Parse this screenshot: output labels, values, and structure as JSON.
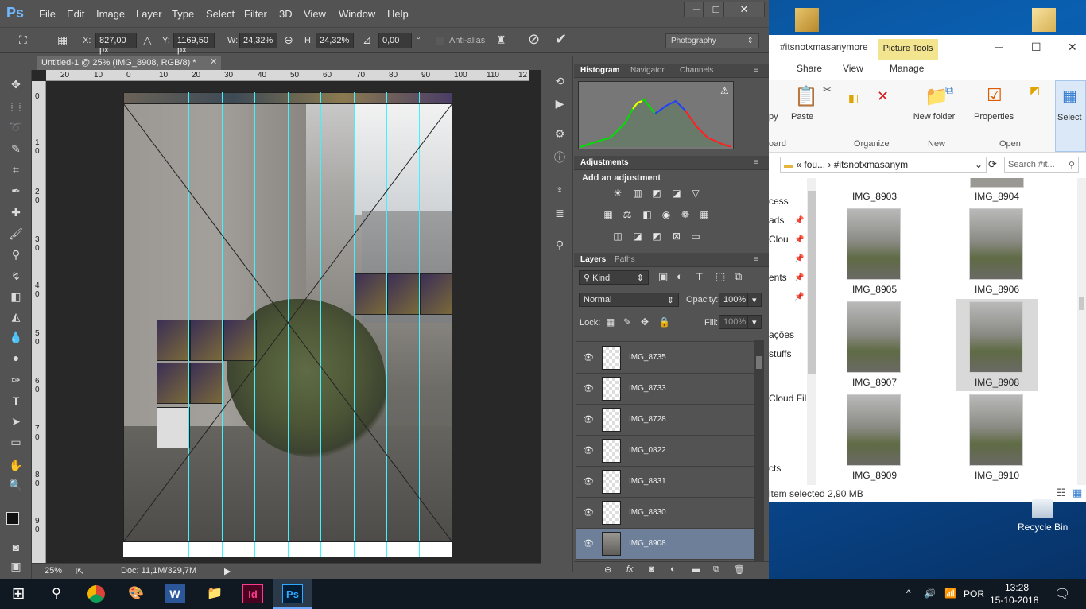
{
  "photoshop": {
    "logo": "Ps",
    "menu": [
      "File",
      "Edit",
      "Image",
      "Layer",
      "Type",
      "Select",
      "Filter",
      "3D",
      "View",
      "Window",
      "Help"
    ],
    "options": {
      "x_label": "X:",
      "x_value": "827,00 px",
      "y_label": "Y:",
      "y_value": "1169,50 px",
      "w_label": "W:",
      "w_value": "24,32%",
      "h_label": "H:",
      "h_value": "24,32%",
      "angle_value": "0,00",
      "angle_unit": "°",
      "anti_alias_label": "Anti-alias",
      "workspace": "Photography"
    },
    "document_tab": "Untitled-1 @ 25% (IMG_8908, RGB/8) *",
    "ruler_top_ticks": [
      "20",
      "10",
      "0",
      "10",
      "20",
      "30",
      "40",
      "50",
      "60",
      "70",
      "80",
      "90",
      "100",
      "110",
      "12"
    ],
    "ruler_left_ticks": [
      "0",
      "1 0",
      "2 0",
      "3 0",
      "4 0",
      "5 0",
      "6 0",
      "7 0",
      "8 0",
      "9 0"
    ],
    "status": {
      "zoom": "25%",
      "doc_size": "Doc: 11,1M/329,7M"
    },
    "panels": {
      "tabs_top": [
        "Histogram",
        "Navigator",
        "Channels"
      ],
      "adjustments_tab": "Adjustments",
      "add_adjustment": "Add an adjustment",
      "layers_tabs": [
        "Layers",
        "Paths"
      ],
      "kind_label": "Kind",
      "blend_mode": "Normal",
      "opacity_label": "Opacity:",
      "opacity_value": "100%",
      "lock_label": "Lock:",
      "fill_label": "Fill:",
      "fill_value": "100%",
      "layers": [
        "IMG_8735",
        "IMG_8733",
        "IMG_8728",
        "IMG_0822",
        "IMG_8831",
        "IMG_8830",
        "IMG_8908"
      ]
    }
  },
  "explorer": {
    "title": "#itsnotxmasanymore",
    "picture_tools": "Picture Tools",
    "ribbon_tabs": [
      "Share",
      "View",
      "Manage"
    ],
    "buttons": {
      "copy": "py",
      "paste": "Paste",
      "new_folder": "New folder",
      "properties": "Properties",
      "select": "Select"
    },
    "groups": [
      "oard",
      "Organize",
      "New",
      "Open"
    ],
    "address": [
      "fou...",
      "#itsnotxmasanym"
    ],
    "search_placeholder": "Search #it...",
    "nav_items": [
      "cess",
      "ads",
      "Clou",
      "ents",
      "ações",
      "stuffs",
      "Cloud Fil",
      "cts"
    ],
    "files": [
      "IMG_8903",
      "IMG_8904",
      "IMG_8905",
      "IMG_8906",
      "IMG_8907",
      "IMG_8908",
      "IMG_8909",
      "IMG_8910"
    ],
    "status": "item selected  2,90 MB"
  },
  "desktop": {
    "recycle_bin": "Recycle Bin"
  },
  "taskbar": {
    "language": "POR",
    "time": "13:28",
    "date": "15-10-2018"
  }
}
